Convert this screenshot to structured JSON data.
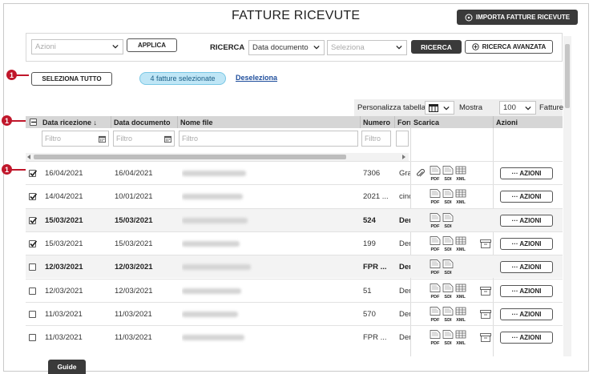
{
  "header": {
    "title": "FATTURE RICEVUTE",
    "import_label": "IMPORTA FATTURE RICEVUTE"
  },
  "actions_panel": {
    "azioni_placeholder": "Azioni",
    "applica_label": "APPLICA",
    "ricerca_label": "RICERCA",
    "search_field_value": "Data documento",
    "search_value_placeholder": "Seleziona",
    "ricerca_button": "RICERCA",
    "advanced_button": "RICERCA AVANZATA"
  },
  "selection": {
    "select_all_label": "SELEZIONA TUTTO",
    "selected_info": "4 fatture selezionate",
    "deselect_label": "Deseleziona"
  },
  "badges": {
    "number": "1"
  },
  "table_tools": {
    "personalizza_label": "Personalizza tabella",
    "mostra_label": "Mostra",
    "page_size": "100",
    "fatture_label": "Fatture"
  },
  "table": {
    "headers": {
      "data_ricezione": "Data ricezione",
      "sort_arrow": "↓",
      "data_documento": "Data documento",
      "nome_file": "Nome file",
      "numero": "Numero",
      "fornitore": "Forn",
      "scarica": "Scarica",
      "azioni": "Azioni"
    },
    "filter_placeholder": "Filtro",
    "download_labels": {
      "pdf": "PDF",
      "sdi": "SDI",
      "xml": "XML"
    },
    "azioni_button": "··· AZIONI",
    "rows": [
      {
        "checked": true,
        "bold": false,
        "data_ricezione": "16/04/2021",
        "data_documento": "16/04/2021",
        "numero": "7306",
        "fornitore": "Gra",
        "attachment": true,
        "archive": false,
        "icons": 3
      },
      {
        "checked": true,
        "bold": false,
        "data_ricezione": "14/04/2021",
        "data_documento": "10/01/2021",
        "numero": "2021 ...",
        "fornitore": "cinc",
        "attachment": false,
        "archive": false,
        "icons": 3
      },
      {
        "checked": true,
        "bold": true,
        "data_ricezione": "15/03/2021",
        "data_documento": "15/03/2021",
        "numero": "524",
        "fornitore": "Der",
        "attachment": false,
        "archive": false,
        "icons": 2
      },
      {
        "checked": true,
        "bold": false,
        "data_ricezione": "15/03/2021",
        "data_documento": "15/03/2021",
        "numero": "199",
        "fornitore": "Der",
        "attachment": false,
        "archive": true,
        "icons": 3
      },
      {
        "checked": false,
        "bold": true,
        "data_ricezione": "12/03/2021",
        "data_documento": "12/03/2021",
        "numero": "FPR ...",
        "fornitore": "Der",
        "attachment": false,
        "archive": false,
        "icons": 2
      },
      {
        "checked": false,
        "bold": false,
        "data_ricezione": "12/03/2021",
        "data_documento": "12/03/2021",
        "numero": "51",
        "fornitore": "Der",
        "attachment": false,
        "archive": true,
        "icons": 3
      },
      {
        "checked": false,
        "bold": false,
        "data_ricezione": "11/03/2021",
        "data_documento": "11/03/2021",
        "numero": "570",
        "fornitore": "Der",
        "attachment": false,
        "archive": true,
        "icons": 3
      },
      {
        "checked": false,
        "bold": false,
        "data_ricezione": "11/03/2021",
        "data_documento": "11/03/2021",
        "numero": "FPR ...",
        "fornitore": "Der",
        "attachment": false,
        "archive": true,
        "icons": 3
      }
    ]
  },
  "footer": {
    "guide_label": "Guide"
  }
}
